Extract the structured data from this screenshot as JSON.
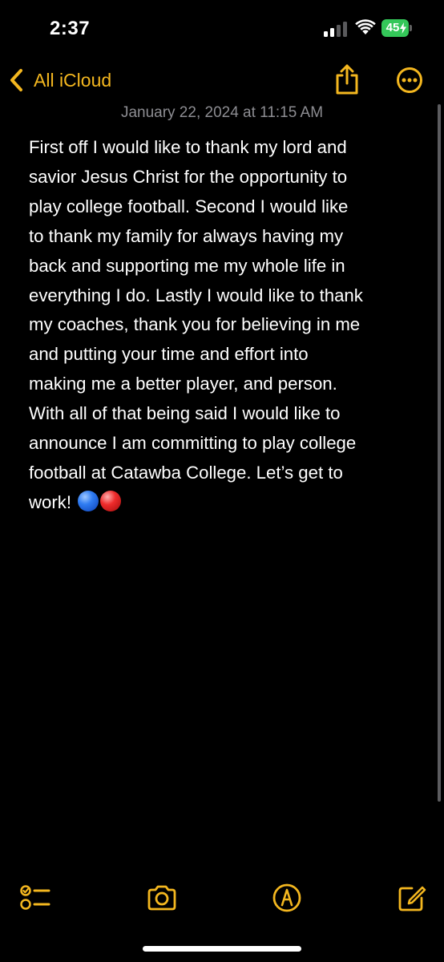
{
  "status_bar": {
    "time": "2:37",
    "battery": "45"
  },
  "nav": {
    "back_label": "All iCloud",
    "back_icon": "chevron-left-icon",
    "share_icon": "share-icon",
    "more_icon": "ellipsis-circle-icon"
  },
  "note": {
    "date": "January 22, 2024 at 11:15 AM",
    "text": "First off I would like to thank my lord and\nsavior Jesus Christ for the opportunity to\nplay college football. Second I would like\nto thank my family for always having my\nback and supporting me my whole life in\neverything I do. Lastly I would like to thank\nmy coaches, thank you for believing in me\nand putting your time and effort into\nmaking me a better player, and person.\nWith all of that being said I would like to\nannounce I am committing to play college\nfootball at Catawba College. Let’s get to\nwork! ",
    "emoji": [
      "blue-circle",
      "red-circle"
    ]
  },
  "toolbar": {
    "items": [
      "checklist-icon",
      "camera-icon",
      "markup-icon",
      "compose-icon"
    ]
  },
  "colors": {
    "accent": "#f4b71f",
    "background": "#000000",
    "text": "#ffffff",
    "date": "#8d8d92",
    "battery": "#34c759"
  }
}
